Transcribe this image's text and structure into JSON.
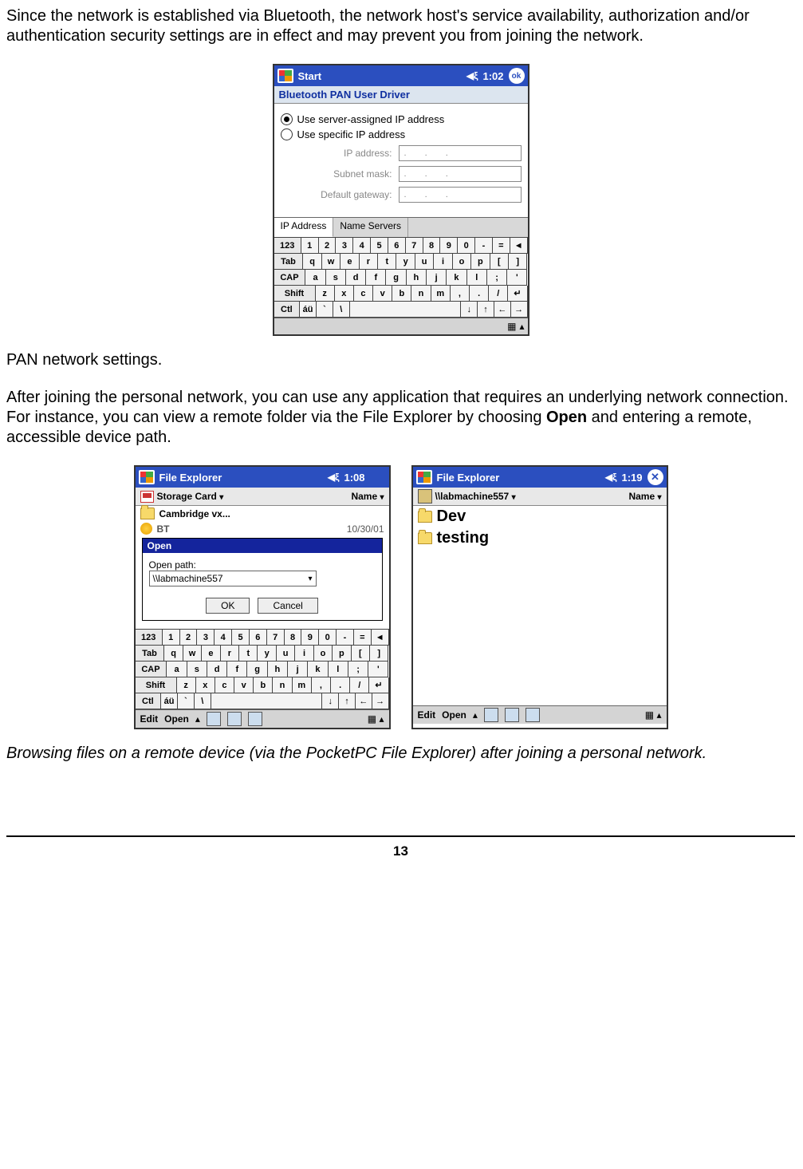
{
  "intro_para": "Since the network is established via Bluetooth, the network host's service availability, authorization and/or authentication security settings are in effect and may prevent you from joining the network.",
  "pan_caption": "PAN network settings.",
  "after_para_pre": "After joining the personal network, you can use any application that requires an underlying network connection. For instance, you can view a remote folder via the File Explorer by choosing ",
  "after_para_bold": "Open",
  "after_para_post": " and entering a remote, accessible device path.",
  "browse_caption": "Browsing files on a remote device (via the PocketPC File Explorer) after joining a personal network.",
  "page_number": "13",
  "dev1": {
    "title": "Start",
    "time": "1:02",
    "ok": "ok",
    "subheader": "Bluetooth PAN User Driver",
    "radio1": "Use server-assigned IP address",
    "radio2": "Use specific IP address",
    "field_ip": "IP address:",
    "field_sub": "Subnet mask:",
    "field_gw": "Default gateway:",
    "dots": ".   .   .",
    "tab1": "IP Address",
    "tab2": "Name Servers"
  },
  "sip": {
    "r1": [
      "123",
      "1",
      "2",
      "3",
      "4",
      "5",
      "6",
      "7",
      "8",
      "9",
      "0",
      "-",
      "=",
      "◄"
    ],
    "r2": [
      "Tab",
      "q",
      "w",
      "e",
      "r",
      "t",
      "y",
      "u",
      "i",
      "o",
      "p",
      "[",
      "]"
    ],
    "r3": [
      "CAP",
      "a",
      "s",
      "d",
      "f",
      "g",
      "h",
      "j",
      "k",
      "l",
      ";",
      "'"
    ],
    "r4": [
      "Shift",
      "z",
      "x",
      "c",
      "v",
      "b",
      "n",
      "m",
      ",",
      ".",
      "/",
      "↵"
    ],
    "r5": [
      "Ctl",
      "áü",
      "`",
      "\\",
      " ",
      "↓",
      "↑",
      "←",
      "→"
    ]
  },
  "fe1": {
    "title": "File Explorer",
    "time": "1:08",
    "loc": "Storage Card",
    "sort": "Name",
    "item1": "Cambridge vx...",
    "item2": "BT",
    "item2_meta": "10/30/01",
    "dlg_title": "Open",
    "dlg_label": "Open path:",
    "dlg_value": "\\\\labmachine557",
    "ok": "OK",
    "cancel": "Cancel",
    "bb_edit": "Edit",
    "bb_open": "Open"
  },
  "fe2": {
    "title": "File Explorer",
    "time": "1:19",
    "loc": "\\\\labmachine557",
    "sort": "Name",
    "item1": "Dev",
    "item2": "testing",
    "bb_edit": "Edit",
    "bb_open": "Open"
  }
}
